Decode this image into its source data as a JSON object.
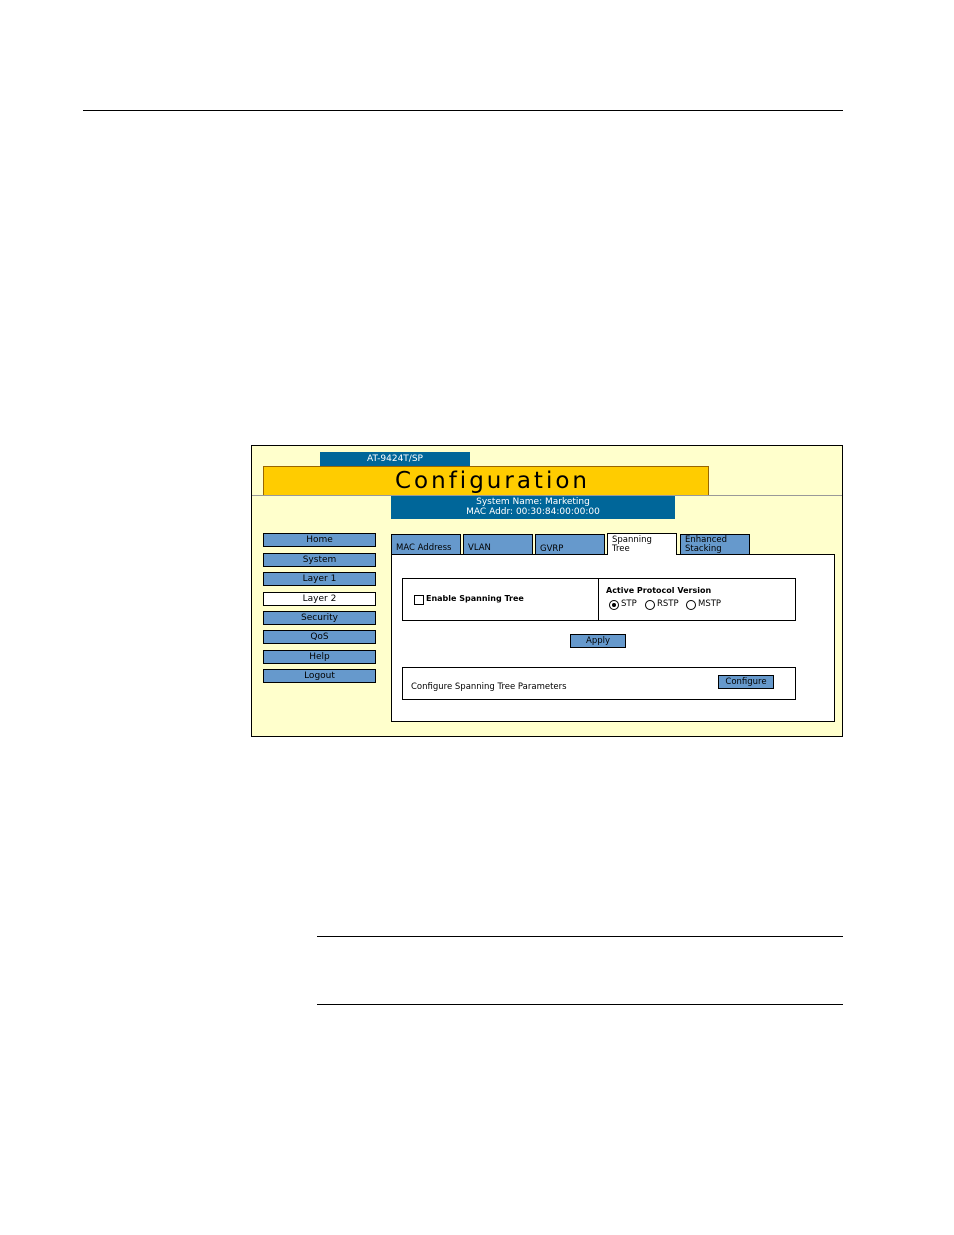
{
  "device": {
    "model": "AT-9424T/SP",
    "title": "Configuration",
    "system_name": "System Name: Marketing",
    "mac_addr": "MAC Addr: 00:30:84:00:00:00"
  },
  "nav": {
    "items": [
      {
        "label": "Home"
      },
      {
        "label": "System"
      },
      {
        "label": "Layer 1"
      },
      {
        "label": "Layer 2"
      },
      {
        "label": "Security"
      },
      {
        "label": "QoS"
      },
      {
        "label": "Help"
      },
      {
        "label": "Logout"
      }
    ],
    "active": "Layer 2"
  },
  "tabs": [
    {
      "line1": "MAC Address",
      "line2": ""
    },
    {
      "line1": "VLAN",
      "line2": ""
    },
    {
      "line1": "GVRP",
      "line2": ""
    },
    {
      "line1": "Spanning",
      "line2": "Tree"
    },
    {
      "line1": "Enhanced",
      "line2": "Stacking"
    }
  ],
  "active_tab": "Spanning Tree",
  "form": {
    "enable_label": "Enable Spanning Tree",
    "enable_checked": false,
    "protocol_label": "Active Protocol Version",
    "protocol_options": [
      "STP",
      "RSTP",
      "MSTP"
    ],
    "protocol_selected": "STP",
    "apply_label": "Apply",
    "configure_desc": "Configure Spanning Tree Parameters",
    "configure_label": "Configure"
  },
  "colors": {
    "banner": "#ffcc00",
    "panel_bg": "#ffffcc",
    "header_blue": "#006699",
    "button_blue": "#6699cc"
  }
}
